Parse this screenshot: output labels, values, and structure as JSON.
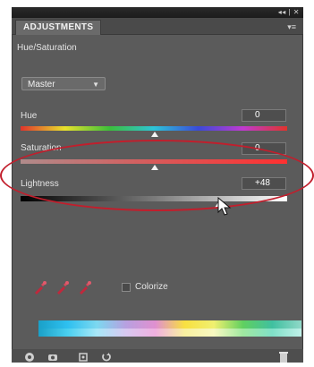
{
  "window": {
    "controls": "◂◂ | ✕"
  },
  "tab": {
    "label": "ADJUSTMENTS"
  },
  "panel": {
    "subtitle": "Hue/Saturation",
    "preset": "Master"
  },
  "sliders": {
    "hue": {
      "label": "Hue",
      "value": "0",
      "position": 0.5
    },
    "saturation": {
      "label": "Saturation",
      "value": "0",
      "position": 0.5
    },
    "lightness": {
      "label": "Lightness",
      "value": "+48",
      "position": 0.74
    }
  },
  "colorize": {
    "label": "Colorize",
    "checked": false
  },
  "colors": {
    "panel_bg": "#5b5b5b",
    "highlight_ellipse": "#c21e2c",
    "eyedropper": "#c0283c"
  },
  "icons": {
    "eyedroppers": [
      "eyedropper-icon",
      "eyedropper-plus-icon",
      "eyedropper-minus-icon"
    ],
    "bottom": [
      "return-icon",
      "view-icon",
      "clip-icon",
      "reset-icon",
      "trash-icon"
    ]
  }
}
